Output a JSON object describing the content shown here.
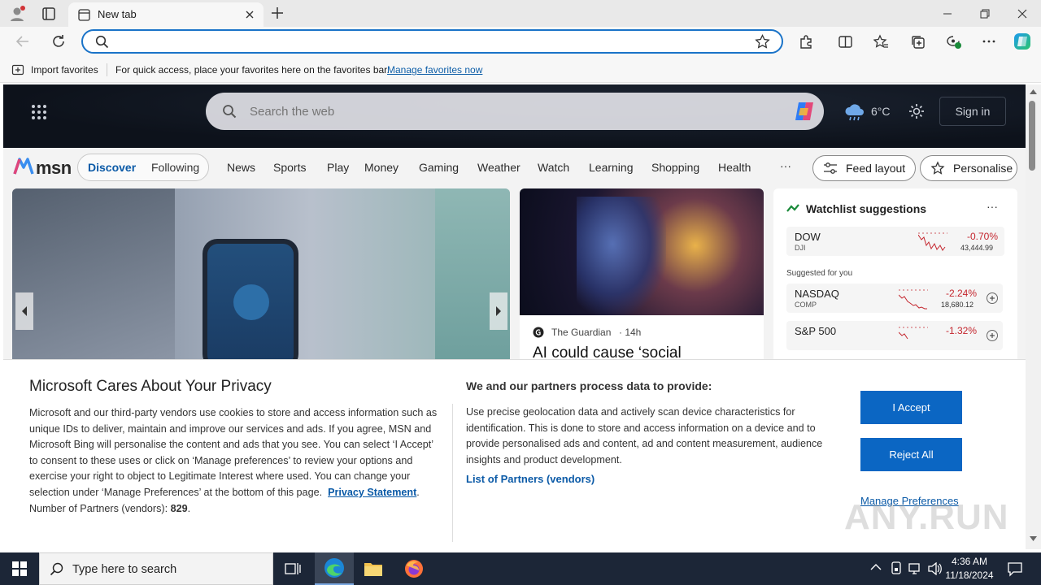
{
  "browser": {
    "tab_title": "New tab",
    "address_placeholder": "",
    "favorites_bar": {
      "import_label": "Import favorites",
      "hint_text": "For quick access, place your favorites here on the favorites bar.",
      "manage_link": "Manage favorites now"
    }
  },
  "msn": {
    "search_placeholder": "Search the web",
    "weather_temp": "6°C",
    "sign_in_label": "Sign in",
    "logo_text": "msn",
    "pills": [
      "Discover",
      "Following"
    ],
    "nav": [
      "News",
      "Sports",
      "Play",
      "Money",
      "Gaming",
      "Weather",
      "Watch",
      "Learning",
      "Shopping",
      "Health",
      "···"
    ],
    "feed_layout_label": "Feed layout",
    "personalise_label": "Personalise",
    "ai_card": {
      "source": "The Guardian",
      "age": "· 14h",
      "headline": "AI could cause ‘social"
    },
    "watchlist": {
      "title": "Watchlist suggestions",
      "more": "···",
      "suggested_label": "Suggested for you",
      "items": [
        {
          "name": "DOW",
          "code": "DJI",
          "change": "-0.70%",
          "price": "43,444.99"
        },
        {
          "name": "NASDAQ",
          "code": "COMP",
          "change": "-2.24%",
          "price": "18,680.12"
        },
        {
          "name": "S&P 500",
          "code": "",
          "change": "-1.32%",
          "price": ""
        }
      ]
    }
  },
  "privacy": {
    "title": "Microsoft Cares About Your Privacy",
    "body": "Microsoft and our third-party vendors use cookies to store and access information such as unique IDs to deliver, maintain and improve our services and ads. If you agree, MSN and Microsoft Bing will personalise the content and ads that you see. You can select ‘I Accept’ to consent to these uses or click on ‘Manage preferences’ to review your options and exercise your right to object to Legitimate Interest where used.  You can change your selection under ‘Manage Preferences’ at the bottom of this page.",
    "privacy_link": "Privacy Statement",
    "partners_text": "Number of Partners (vendors):",
    "partners_count": "829",
    "right_title": "We and our partners process data to provide:",
    "right_body": "Use precise geolocation data and actively scan device characteristics for identification. This is done to store and access information on a device and to provide personalised ads and content, ad and content measurement, audience insights and product development.",
    "partners_link": "List of Partners (vendors)",
    "accept_label": "I Accept",
    "reject_label": "Reject All",
    "manage_label": "Manage Preferences"
  },
  "taskbar": {
    "search_placeholder": "Type here to search",
    "time": "4:36 AM",
    "date": "11/18/2024"
  },
  "watermark": "ANY.RUN",
  "colors": {
    "accent": "#0b66c3",
    "taskbar": "#1c2637",
    "negative": "#c4262e"
  }
}
